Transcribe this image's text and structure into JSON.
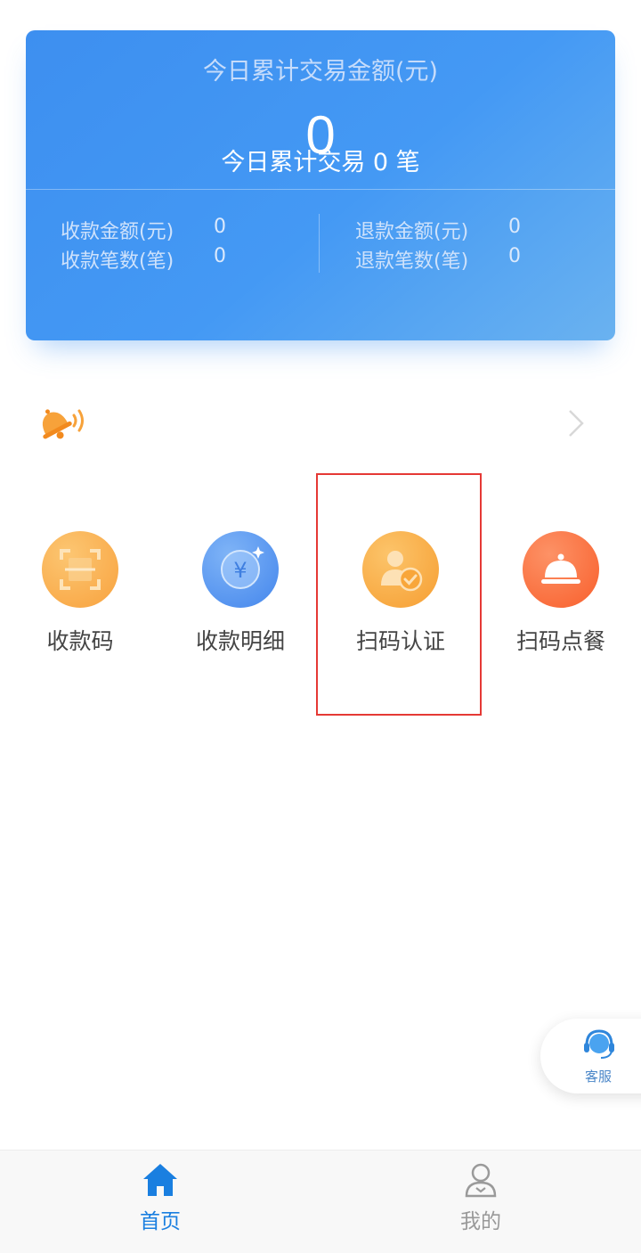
{
  "summary": {
    "title": "今日累计交易金额(元)",
    "amount": "0",
    "count_text": "今日累计交易 0 笔",
    "stats": {
      "receive_amount_label": "收款金额(元)",
      "receive_amount_value": "0",
      "receive_count_label": "收款笔数(笔)",
      "receive_count_value": "0",
      "refund_amount_label": "退款金额(元)",
      "refund_amount_value": "0",
      "refund_count_label": "退款笔数(笔)",
      "refund_count_value": "0"
    }
  },
  "notice": {
    "icon": "bell-icon"
  },
  "menu": [
    {
      "label": "收款码",
      "icon": "qr-scan-icon",
      "color": "#f9a646"
    },
    {
      "label": "收款明细",
      "icon": "yuan-coin-icon",
      "color": "#4d8ff0"
    },
    {
      "label": "扫码认证",
      "icon": "user-verified-icon",
      "color": "#f8a63a"
    },
    {
      "label": "扫码点餐",
      "icon": "food-cloche-icon",
      "color": "#fb6b3a"
    }
  ],
  "service": {
    "label": "客服",
    "icon": "headset-icon"
  },
  "tabs": [
    {
      "label": "首页",
      "icon": "home-icon",
      "active": true,
      "color": "#1a7fe0"
    },
    {
      "label": "我的",
      "icon": "user-icon",
      "active": false,
      "color": "#999999"
    }
  ],
  "colors": {
    "accent": "#1a7fe0",
    "highlight": "#e53935"
  }
}
